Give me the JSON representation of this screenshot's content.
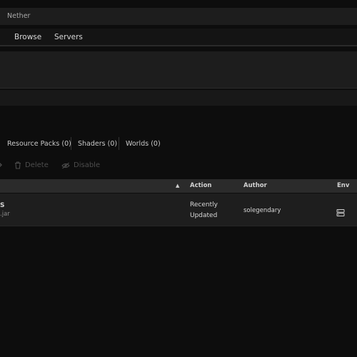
{
  "breadcrumb": {
    "text": "Nether"
  },
  "nav": {
    "items": [
      {
        "label": ""
      },
      {
        "label": "Browse"
      },
      {
        "label": "Servers"
      }
    ]
  },
  "content_tabs": [
    {
      "label": "Resource Packs (0)"
    },
    {
      "label": "Shaders (0)"
    },
    {
      "label": "Worlds (0)"
    }
  ],
  "actions": {
    "delete_label": "Delete",
    "disable_label": "Disable"
  },
  "table": {
    "columns": {
      "action": "Action",
      "author": "Author",
      "env": "Env"
    },
    "rows": [
      {
        "name": "S",
        "filename": ".jar",
        "action_line1": "Recently",
        "action_line2": "Updated",
        "author": "solegendary",
        "env_icon": "server-icon"
      }
    ]
  },
  "colors": {
    "background": "#0d0d0d",
    "panel": "#1d1d1d",
    "header": "#2b2b2b",
    "disabled_text": "#4d4d4d"
  }
}
